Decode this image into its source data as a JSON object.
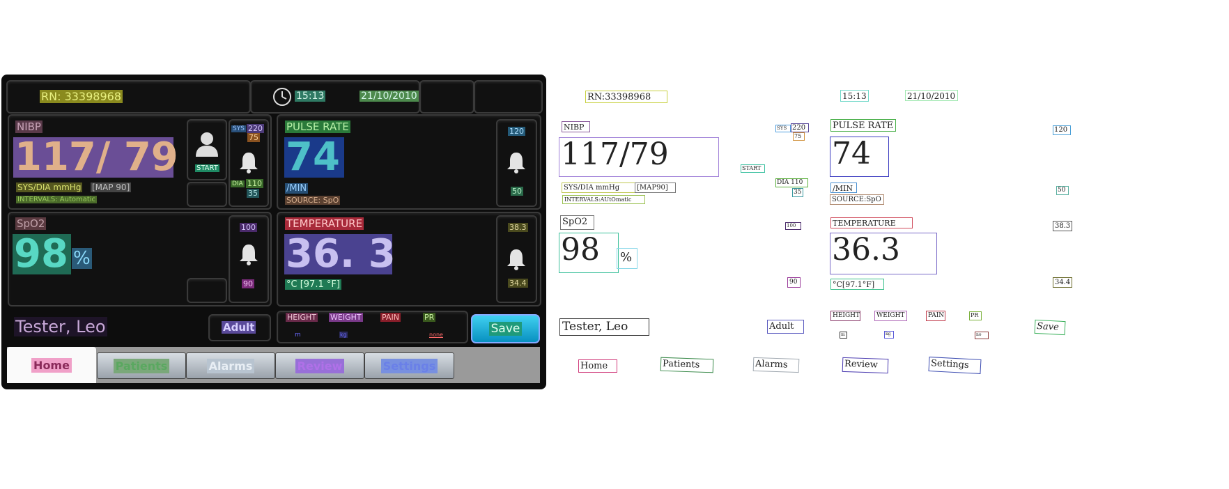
{
  "header": {
    "rn": "RN: 33398968",
    "time": "15:13",
    "date": "21/10/2010"
  },
  "nibp": {
    "title": "NIBP",
    "value": "117/ 79",
    "units": "SYS/DIA  mmHg",
    "map": "[MAP 90]",
    "intervals": "INTERVALS: Automatic",
    "start": "START",
    "sys_label": "SYS",
    "sys_high": "220",
    "sys_low": "75",
    "dia_label": "DIA",
    "dia_high": "110",
    "dia_low": "35"
  },
  "pulse": {
    "title": "PULSE RATE",
    "value": "74",
    "unit": "/MIN",
    "source": "SOURCE: SpO",
    "high": "120",
    "low": "50"
  },
  "spo2": {
    "title": "SpO2",
    "value": "98",
    "unit": "%",
    "high": "100",
    "low": "90"
  },
  "temp": {
    "title": "TEMPERATURE",
    "value": "36. 3",
    "unit": "°C [97.1 °F]",
    "high": "38.3",
    "low": "34.4"
  },
  "patient": {
    "name": "Tester, Leo",
    "type": "Adult"
  },
  "info": {
    "height": "HEIGHT",
    "weight": "WEIGHT",
    "pain": "PAIN",
    "pr": "PR",
    "height_unit": "m",
    "weight_unit": "kg",
    "pain_value": "none"
  },
  "save": "Save",
  "tabs": [
    "Home",
    "Patients",
    "Alarms",
    "Review",
    "Settings"
  ],
  "overlay": {
    "rn": "RN:33398968",
    "time": "15:13",
    "date": "21/10/2010",
    "nibp": "NIBP",
    "nibp_value": "117/79",
    "units": "SYS/DIA mmHg",
    "map": "[MAP90]",
    "intervals": "INTERVALS:AUtOmatic",
    "sys": "SYS",
    "sys_high": "220",
    "sys_low": "75",
    "start": "START",
    "dia": "DIA 110",
    "dia_low": "35",
    "pulse": "PULSE RATE",
    "pulse_value": "74",
    "min": "/MIN",
    "source": "SOURCE:SpO",
    "pulse_high": "120",
    "pulse_low": "50",
    "spo2": "SpO2",
    "spo2_value": "98",
    "pct": "%",
    "spo2_high": "100",
    "spo2_low": "90",
    "temp": "TEMPERATURE",
    "temp_value": "36.3",
    "temp_unit": "°C[97.1°F]",
    "temp_high": "38.3",
    "temp_low": "34.4",
    "name": "Tester, Leo",
    "adult": "Adult",
    "height": "HEIGHT",
    "weight": "WEIGHT",
    "pain": "PAIN",
    "pr": "PR",
    "m": "m",
    "kg": "kg",
    "none": "no",
    "save": "Save",
    "tabs": [
      "Home",
      "Patients",
      "Alarms",
      "Review",
      "Settings"
    ]
  }
}
